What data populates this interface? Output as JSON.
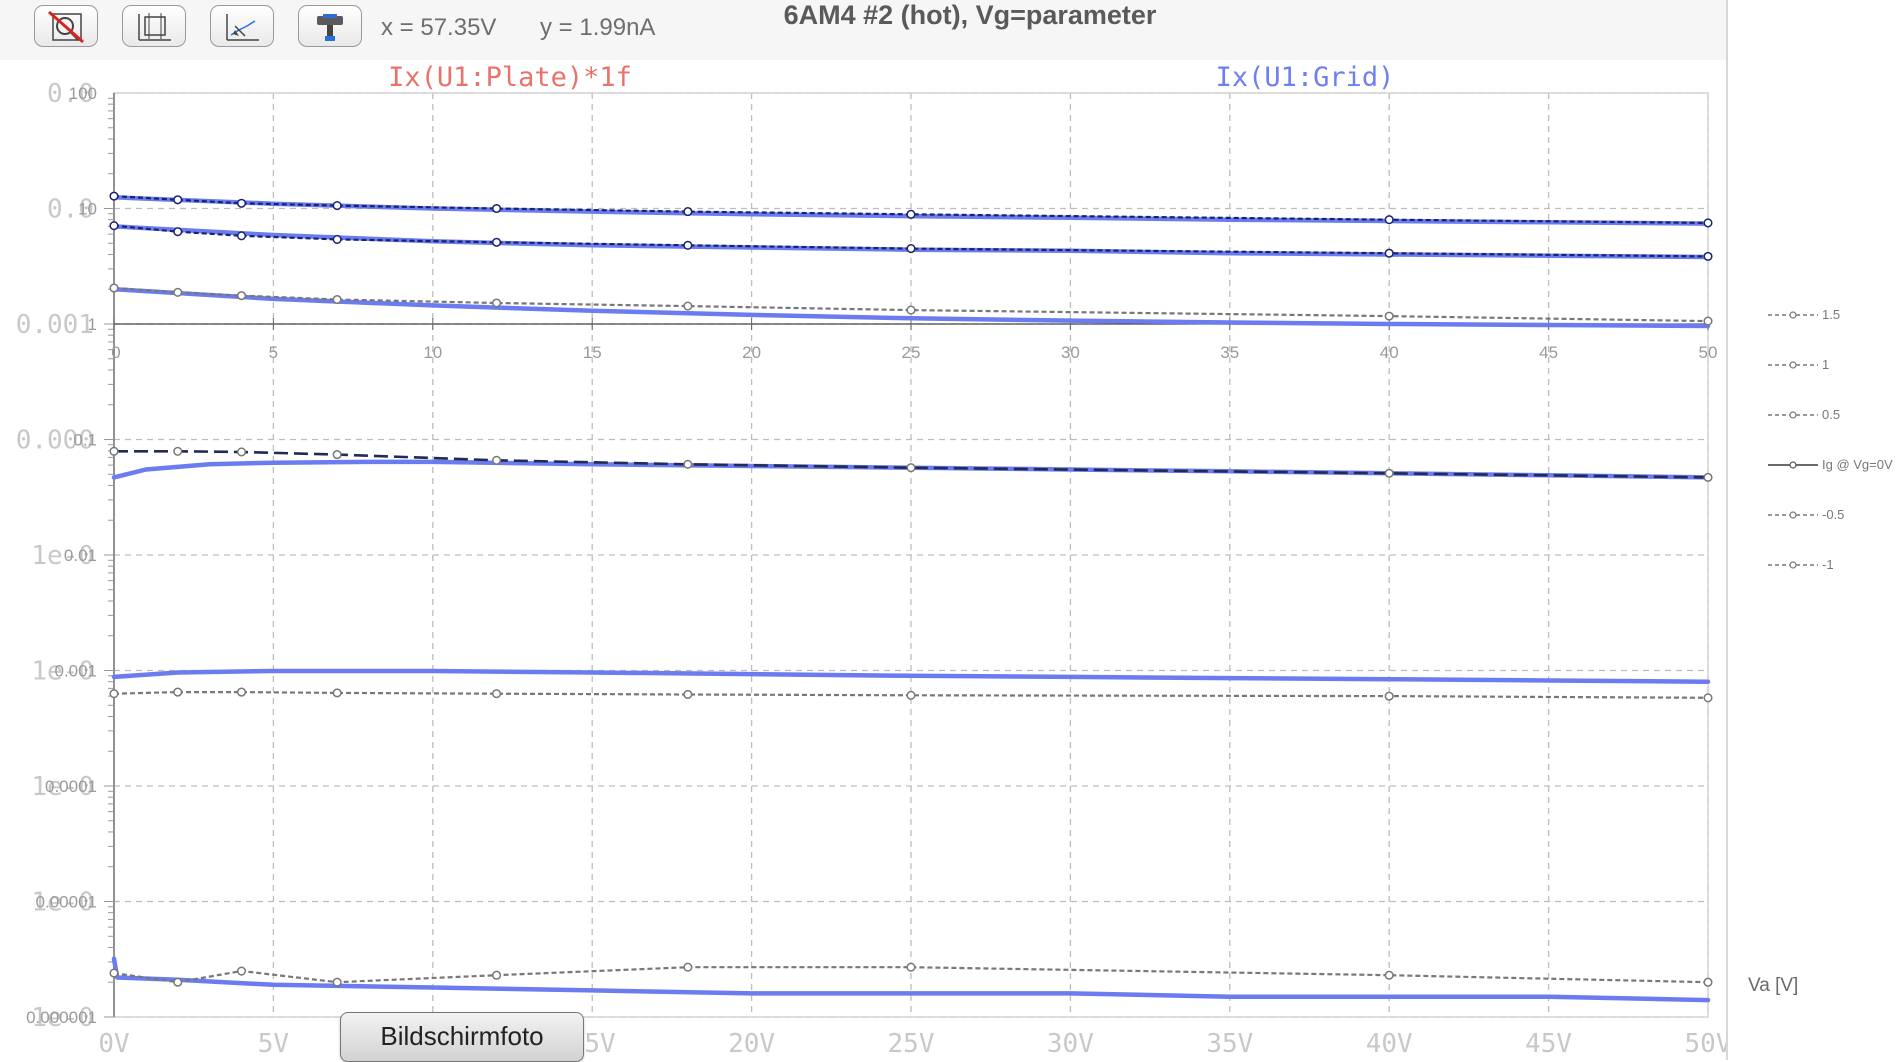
{
  "window": {
    "title": "6AM4 #2 (hot), Vg=parameter"
  },
  "toolbar": {
    "buttons": [
      {
        "name": "autorange-off-button",
        "icon": "zoom-off-icon"
      },
      {
        "name": "zoom-extents-button",
        "icon": "zoom-extents-icon"
      },
      {
        "name": "zoom-back-button",
        "icon": "zoom-back-icon"
      },
      {
        "name": "paint-tool-button",
        "icon": "paint-tool-icon"
      }
    ],
    "cursor_x": "x = 57.35V",
    "cursor_y": "y = 1.99nA"
  },
  "traces": {
    "plate_label": "Ix(U1:Plate)*1f",
    "grid_label": "Ix(U1:Grid)"
  },
  "colors": {
    "plate_trace": "#e8736a",
    "grid_trace": "#6e7ff0",
    "spice_line": "#6b7cf0",
    "meas_dark": "#1a2270",
    "meas_gray": "#777777",
    "grid_lines": "#bdbdbd",
    "axis_text": "#c8c8c8",
    "overlay_text": "#9a9a9a",
    "overlay_tick": "#9a9a9a"
  },
  "chart_data": {
    "type": "line",
    "x_axis": {
      "unit": "V",
      "range": [
        0,
        50
      ],
      "ticks": [
        0,
        5,
        10,
        15,
        20,
        25,
        30,
        35,
        40,
        45,
        50
      ],
      "tick_labels": [
        "0V",
        "5V",
        "10V",
        "15V",
        "20V",
        "25V",
        "30V",
        "35V",
        "40V",
        "45V",
        "50V"
      ]
    },
    "y_axis_background": {
      "scale": "log",
      "tick_labels": [
        "0.0",
        "0.0",
        "0.001",
        "0.000",
        "1e-0",
        "1e-0",
        "1e-0",
        "1e-0",
        "1e-0"
      ]
    },
    "overlay": {
      "y_scale": "log",
      "y_ticks": [
        "100",
        "10",
        "1",
        "0.1",
        "0.01",
        "0.001",
        "0.0001",
        "0.00001",
        "0.000001"
      ],
      "y_range": [
        1e-06,
        100
      ],
      "x_ticks": [
        "0",
        "5",
        "10",
        "15",
        "20",
        "25",
        "30",
        "35",
        "40",
        "45",
        "50"
      ],
      "x_range": [
        0,
        50
      ],
      "x_axis_at_y": 1,
      "x_label": "Va [V]",
      "legend": [
        "1.5",
        "1",
        "0.5",
        "Ig @ Vg=0V",
        "-0.5",
        "-1"
      ]
    },
    "spice_series": [
      {
        "x": [
          0,
          5,
          10,
          15,
          20,
          25,
          30,
          35,
          40,
          45,
          50
        ],
        "y": [
          12.5,
          11.0,
          10.0,
          9.4,
          8.9,
          8.6,
          8.3,
          8.0,
          7.8,
          7.6,
          7.4
        ]
      },
      {
        "x": [
          0,
          5,
          10,
          15,
          20,
          25,
          30,
          35,
          40,
          45,
          50
        ],
        "y": [
          7.0,
          5.9,
          5.2,
          4.8,
          4.6,
          4.4,
          4.3,
          4.1,
          4.0,
          3.9,
          3.8
        ]
      },
      {
        "x": [
          0,
          5,
          10,
          15,
          20,
          25,
          30,
          35,
          40,
          45,
          50
        ],
        "y": [
          2.0,
          1.65,
          1.45,
          1.3,
          1.2,
          1.12,
          1.07,
          1.03,
          1.0,
          0.98,
          0.96
        ]
      },
      {
        "x": [
          0,
          1,
          3,
          5,
          8,
          10,
          15,
          20,
          25,
          30,
          35,
          40,
          45,
          50
        ],
        "y": [
          0.047,
          0.055,
          0.061,
          0.063,
          0.064,
          0.064,
          0.061,
          0.059,
          0.057,
          0.055,
          0.053,
          0.051,
          0.049,
          0.047
        ]
      },
      {
        "x": [
          0,
          2,
          5,
          10,
          15,
          20,
          25,
          30,
          35,
          40,
          45,
          50
        ],
        "y": [
          0.00088,
          0.00096,
          0.00099,
          0.00099,
          0.00096,
          0.00093,
          0.0009,
          0.00088,
          0.00086,
          0.00084,
          0.00082,
          0.0008
        ]
      },
      {
        "x": [
          0,
          0.1,
          2,
          5,
          10,
          15,
          20,
          25,
          30,
          35,
          40,
          45,
          50
        ],
        "y": [
          3.2e-06,
          2.2e-06,
          2.1e-06,
          1.9e-06,
          1.8e-06,
          1.7e-06,
          1.6e-06,
          1.6e-06,
          1.6e-06,
          1.5e-06,
          1.5e-06,
          1.5e-06,
          1.4e-06
        ]
      }
    ],
    "measured_series": [
      {
        "label": "1.5",
        "style": "dark",
        "x": [
          0,
          2,
          4,
          7,
          12,
          18,
          25,
          40,
          50
        ],
        "y": [
          12.8,
          11.9,
          11.1,
          10.6,
          10.0,
          9.4,
          8.9,
          8.0,
          7.5
        ]
      },
      {
        "label": "1",
        "style": "dark",
        "x": [
          0,
          2,
          4,
          7,
          12,
          18,
          25,
          40,
          50
        ],
        "y": [
          7.1,
          6.3,
          5.8,
          5.4,
          5.1,
          4.8,
          4.5,
          4.1,
          3.85
        ]
      },
      {
        "label": "0.5",
        "style": "gray",
        "x": [
          0,
          2,
          4,
          7,
          12,
          18,
          25,
          40,
          50
        ],
        "y": [
          2.05,
          1.88,
          1.76,
          1.63,
          1.52,
          1.43,
          1.32,
          1.17,
          1.06
        ]
      },
      {
        "label": "Ig @ Vg=0V",
        "style": "dashed",
        "x": [
          0,
          2,
          4,
          7,
          12,
          18,
          25,
          40,
          50
        ],
        "y": [
          0.079,
          0.079,
          0.078,
          0.074,
          0.066,
          0.061,
          0.057,
          0.051,
          0.047
        ]
      },
      {
        "label": "-0.5",
        "style": "gray",
        "x": [
          0,
          2,
          4,
          7,
          12,
          18,
          25,
          40,
          50
        ],
        "y": [
          0.00063,
          0.00065,
          0.00065,
          0.00064,
          0.00063,
          0.00062,
          0.00061,
          0.0006,
          0.00058
        ]
      },
      {
        "label": "-1",
        "style": "gray",
        "x": [
          0,
          2,
          4,
          7,
          12,
          18,
          25,
          40,
          50
        ],
        "y": [
          2.4e-06,
          2e-06,
          2.5e-06,
          2e-06,
          2.3e-06,
          2.7e-06,
          2.7e-06,
          2.3e-06,
          2e-06
        ]
      }
    ]
  },
  "tooltip": {
    "label": "Bildschirmfoto"
  }
}
